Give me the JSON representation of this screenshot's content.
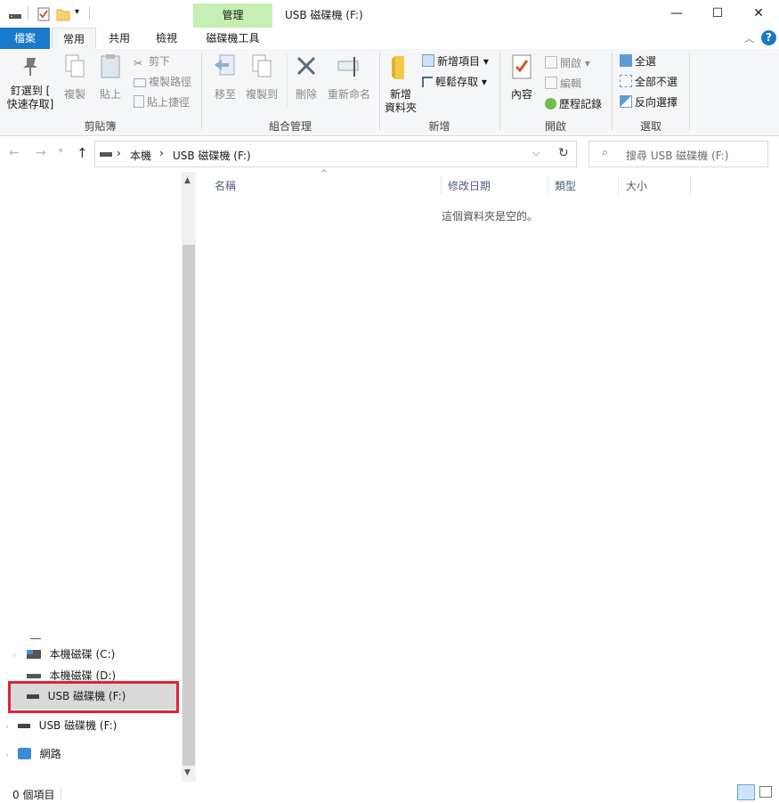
{
  "window": {
    "title": "USB 磁碟機 (F:)",
    "contextual_tab": "管理",
    "minimize_glyph": "—",
    "maximize_glyph": "☐",
    "close_glyph": "✕"
  },
  "tabs": [
    {
      "label": "檔案"
    },
    {
      "label": "常用"
    },
    {
      "label": "共用"
    },
    {
      "label": "檢視"
    },
    {
      "label": "磁碟機工具"
    }
  ],
  "ribbon": {
    "clipboard": {
      "pin": "釘選到 [\n快速存取]",
      "copy": "複製",
      "paste": "貼上",
      "cut": "剪下",
      "copy_path": "複製路徑",
      "paste_shortcut": "貼上捷徑",
      "group": "剪貼簿"
    },
    "organize": {
      "move_to": "移至",
      "copy_to": "複製到",
      "delete": "刪除",
      "rename": "重新命名",
      "group": "組合管理"
    },
    "new": {
      "new_folder": "新增\n資料夾",
      "new_item": "新增項目",
      "easy_access": "輕鬆存取",
      "group": "新增"
    },
    "open": {
      "properties": "內容",
      "open": "開啟",
      "edit": "編輯",
      "history": "歷程記錄",
      "group": "開啟"
    },
    "select": {
      "select_all": "全選",
      "select_none": "全部不選",
      "invert": "反向選擇",
      "group": "選取"
    }
  },
  "address": {
    "crumbs": [
      "本機",
      "USB 磁碟機 (F:)"
    ],
    "search_placeholder": "搜尋 USB 磁碟機 (F:)"
  },
  "columns": [
    "名稱",
    "修改日期",
    "類型",
    "大小"
  ],
  "empty_message": "這個資料夾是空的。",
  "tree": [
    {
      "label": "本機磁碟 (C:)",
      "icon": "windows-drive-icon"
    },
    {
      "label": "本機磁碟 (D:)",
      "icon": "drive-icon"
    },
    {
      "label": "USB 磁碟機 (F:)",
      "icon": "usb-drive-icon",
      "selected": true
    },
    {
      "label": "USB 磁碟機 (F:)",
      "icon": "usb-drive-icon"
    },
    {
      "label": "網路",
      "icon": "network-icon"
    }
  ],
  "status": {
    "item_count": "0 個項目"
  },
  "colors": {
    "file_tab": "#1979ca",
    "context_tab": "#c6efb3",
    "highlight_box": "#e0242f",
    "selected_bg": "#d9d9d9"
  }
}
